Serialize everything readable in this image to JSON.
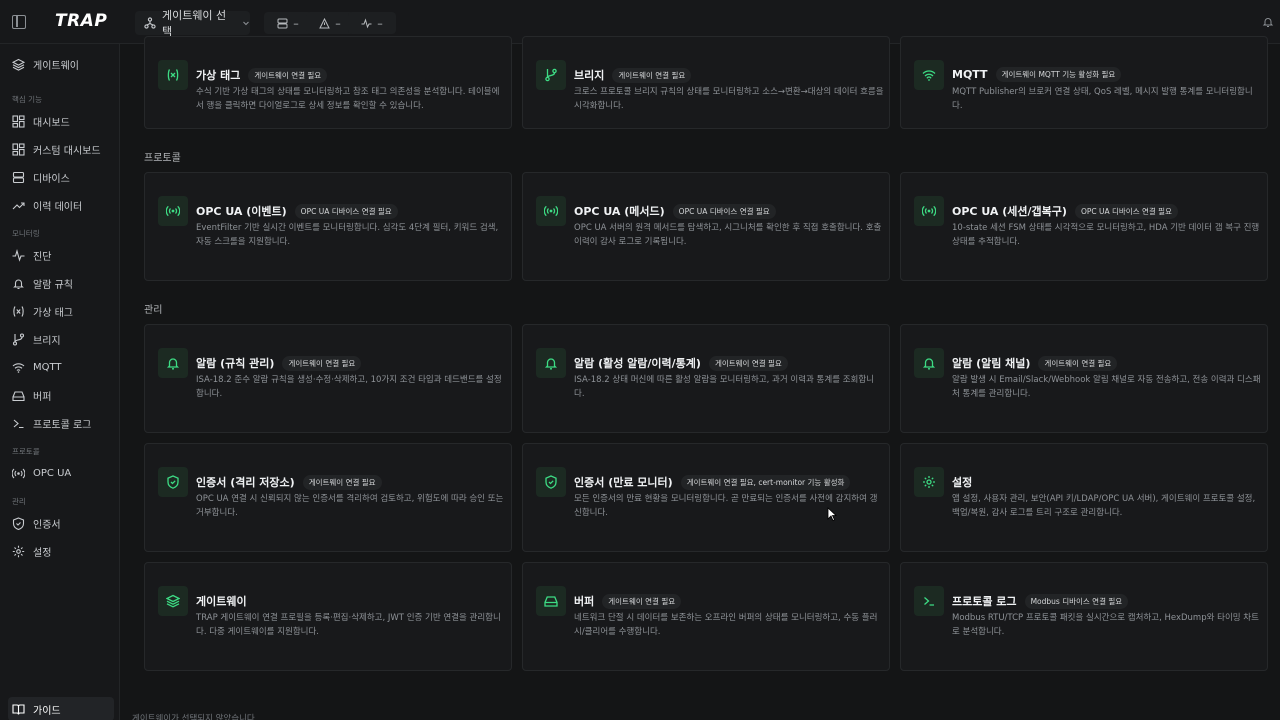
{
  "topbar": {
    "logo": "TRAP",
    "gateway_select": "게이트웨이 선택",
    "chip1": "–",
    "chip2": "–",
    "chip3": "–"
  },
  "sidebar": {
    "gateway": "게이트웨이",
    "section_core": "핵심 기능",
    "dashboard": "대시보드",
    "custom_dashboard": "커스텀 대시보드",
    "devices": "디바이스",
    "history": "이력 데이터",
    "section_monitoring": "모니터링",
    "diagnosis": "진단",
    "alarm_rules": "알람 규칙",
    "virtual_tags": "가상 태그",
    "bridge": "브리지",
    "mqtt": "MQTT",
    "buffer": "버퍼",
    "protocol_log": "프로토콜 로그",
    "section_protocol": "프로토콜",
    "opcua": "OPC UA",
    "section_admin": "관리",
    "certificates": "인증서",
    "settings": "설정",
    "guide": "가이드"
  },
  "main": {
    "top_cards": [
      {
        "title": "가상 태그",
        "badge": "게이트웨이 연결 필요",
        "desc": "수식 기반 가상 태그의 상태를 모니터링하고 참조 태그 의존성을 분석합니다. 테이블에서 행을 클릭하면 다이얼로그로 상세 정보를 확인할 수 있습니다.",
        "icon": "variable-icon"
      },
      {
        "title": "브리지",
        "badge": "게이트웨이 연결 필요",
        "desc": "크로스 프로토콜 브리지 규칙의 상태를 모니터링하고 소스→변환→대상의 데이터 흐름을 시각화합니다.",
        "icon": "branch-icon"
      },
      {
        "title": "MQTT",
        "badge": "게이트웨이 MQTT 기능 활성화 필요",
        "desc": "MQTT Publisher의 브로커 연결 상태, QoS 레벨, 메시지 발행 통계를 모니터링합니다.",
        "icon": "wifi-icon"
      }
    ],
    "section_protocol": "프로토콜",
    "protocol_cards": [
      {
        "title": "OPC UA (이벤트)",
        "badge": "OPC UA 디바이스 연결 필요",
        "desc": "EventFilter 기반 실시간 이벤트를 모니터링합니다. 심각도 4단계 필터, 키워드 검색, 자동 스크롤을 지원합니다.",
        "icon": "broadcast-icon"
      },
      {
        "title": "OPC UA (메서드)",
        "badge": "OPC UA 디바이스 연결 필요",
        "desc": "OPC UA 서버의 원격 메서드를 탐색하고, 시그니처를 확인한 후 직접 호출합니다. 호출 이력이 감사 로그로 기록됩니다.",
        "icon": "broadcast-icon"
      },
      {
        "title": "OPC UA (세션/갭복구)",
        "badge": "OPC UA 디바이스 연결 필요",
        "desc": "10-state 세션 FSM 상태를 시각적으로 모니터링하고, HDA 기반 데이터 갭 복구 진행 상태를 추적합니다.",
        "icon": "broadcast-icon"
      }
    ],
    "section_admin": "관리",
    "admin_cards": [
      {
        "title": "알람 (규칙 관리)",
        "badge": "게이트웨이 연결 필요",
        "desc": "ISA-18.2 준수 알람 규칙을 생성·수정·삭제하고, 10가지 조건 타입과 데드밴드를 설정합니다.",
        "icon": "bell-icon"
      },
      {
        "title": "알람 (활성 알람/이력/통계)",
        "badge": "게이트웨이 연결 필요",
        "desc": "ISA-18.2 상태 머신에 따른 활성 알람을 모니터링하고, 과거 이력과 통계를 조회합니다.",
        "icon": "bell-icon"
      },
      {
        "title": "알람 (알림 채널)",
        "badge": "게이트웨이 연결 필요",
        "desc": "알람 발생 시 Email/Slack/Webhook 알림 채널로 자동 전송하고, 전송 이력과 디스패처 통계를 관리합니다.",
        "icon": "bell-icon"
      },
      {
        "title": "인증서 (격리 저장소)",
        "badge": "게이트웨이 연결 필요",
        "desc": "OPC UA 연결 시 신뢰되지 않는 인증서를 격리하여 검토하고, 위험도에 따라 승인 또는 거부합니다.",
        "icon": "shield-icon"
      },
      {
        "title": "인증서 (만료 모니터)",
        "badge": "게이트웨이 연결 필요, cert-monitor 기능 활성화",
        "desc": "모든 인증서의 만료 현황을 모니터링합니다. 곧 만료되는 인증서를 사전에 감지하여 갱신합니다.",
        "icon": "shield-icon"
      },
      {
        "title": "설정",
        "badge": "",
        "desc": "앱 설정, 사용자 관리, 보안(API 키/LDAP/OPC UA 서버), 게이트웨이 프로토콜 설정, 백업/복원, 감사 로그를 트리 구조로 관리합니다.",
        "icon": "gear-icon"
      },
      {
        "title": "게이트웨이",
        "badge": "",
        "desc": "TRAP 게이트웨이 연결 프로필을 등록·편집·삭제하고, JWT 인증 기반 연결을 관리합니다. 다중 게이트웨이를 지원합니다.",
        "icon": "layers-icon"
      },
      {
        "title": "버퍼",
        "badge": "게이트웨이 연결 필요",
        "desc": "네트워크 단절 시 데이터를 보존하는 오프라인 버퍼의 상태를 모니터링하고, 수동 플러시/클리어를 수행합니다.",
        "icon": "drive-icon"
      },
      {
        "title": "프로토콜 로그",
        "badge": "Modbus 디바이스 연결 필요",
        "desc": "Modbus RTU/TCP 프로토콜 패킷을 실시간으로 캡처하고, HexDump와 타이밍 차트로 분석합니다.",
        "icon": "terminal-icon"
      }
    ],
    "footer": "게이트웨이가 선택되지 않았습니다"
  },
  "colors": {
    "accent": "#3ddc84",
    "background": "#141516",
    "card": "#18191b"
  }
}
